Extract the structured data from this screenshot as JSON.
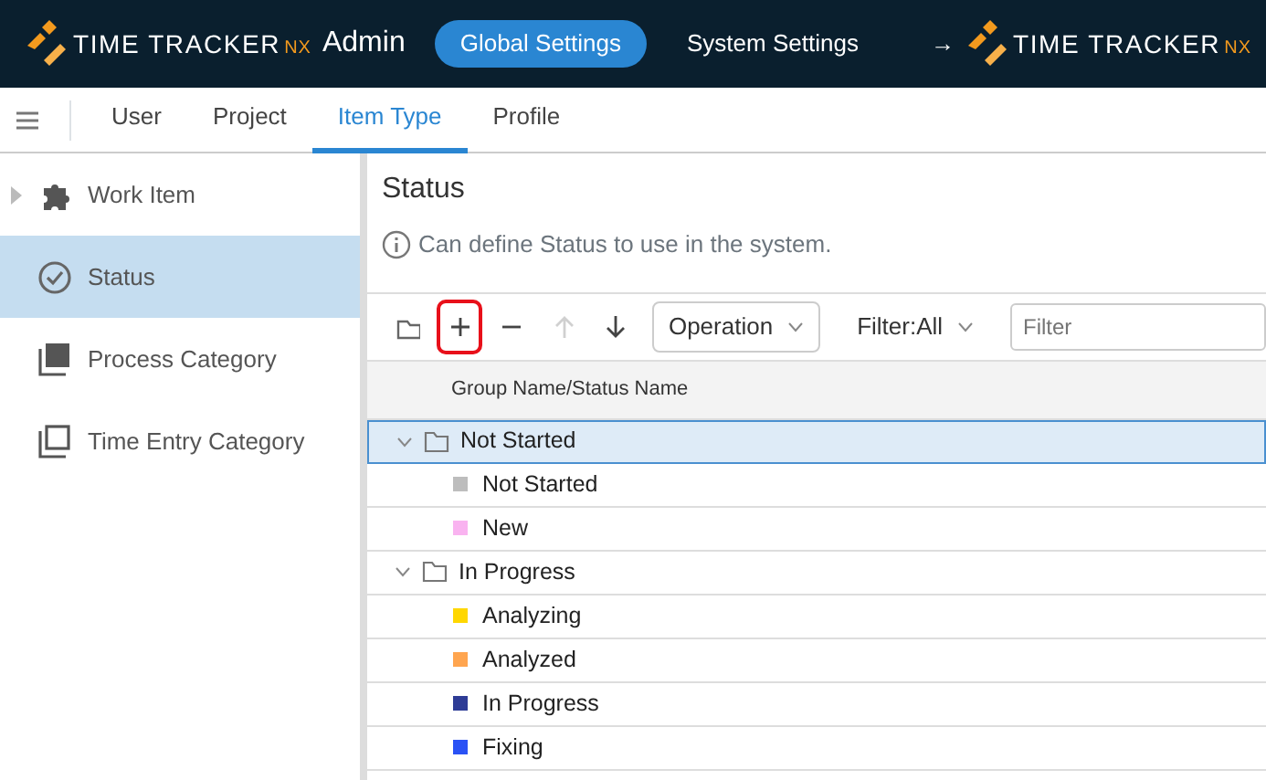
{
  "header": {
    "logo": {
      "name": "TIME TRACKER",
      "suffix": "NX",
      "role": "Admin"
    },
    "tabs": [
      {
        "label": "Global Settings",
        "selected": true
      },
      {
        "label": "System Settings",
        "selected": false
      }
    ],
    "link_arrow": "→",
    "link_logo": {
      "name": "TIME TRACKER",
      "suffix": "NX"
    }
  },
  "nav": {
    "tabs": [
      {
        "label": "User",
        "selected": false
      },
      {
        "label": "Project",
        "selected": false
      },
      {
        "label": "Item Type",
        "selected": true
      },
      {
        "label": "Profile",
        "selected": false
      }
    ]
  },
  "sidebar": {
    "items": [
      {
        "label": "Work Item",
        "kind": "puzzle",
        "selected": false,
        "expandable": true
      },
      {
        "label": "Status",
        "kind": "check",
        "selected": true,
        "expandable": false
      },
      {
        "label": "Process Category",
        "kind": "stack-filled",
        "selected": false,
        "expandable": false
      },
      {
        "label": "Time Entry Category",
        "kind": "stack-outline",
        "selected": false,
        "expandable": false
      }
    ]
  },
  "main": {
    "title": "Status",
    "info": "Can define Status to use in the system.",
    "toolbar": {
      "buttons": [
        {
          "kind": "folder",
          "disabled": false,
          "highlighted": false
        },
        {
          "kind": "add",
          "disabled": false,
          "highlighted": true
        },
        {
          "kind": "remove",
          "disabled": false,
          "highlighted": false
        },
        {
          "kind": "up",
          "disabled": true,
          "highlighted": false
        },
        {
          "kind": "down",
          "disabled": false,
          "highlighted": false
        }
      ],
      "operation": "Operation",
      "filter_menu": "Filter:All",
      "filter": {
        "placeholder": "Filter"
      }
    },
    "tree": {
      "column": "Group Name/Status Name",
      "groups": [
        {
          "label": "Not Started",
          "expanded": true,
          "selected": true,
          "children": [
            {
              "label": "Not Started",
              "color": "#bdbdbd"
            },
            {
              "label": "New",
              "color": "#f9b3f0"
            }
          ]
        },
        {
          "label": "In Progress",
          "expanded": true,
          "selected": false,
          "children": [
            {
              "label": "Analyzing",
              "color": "#ffd700"
            },
            {
              "label": "Analyzed",
              "color": "#ffa54f"
            },
            {
              "label": "In Progress",
              "color": "#2e3c96"
            },
            {
              "label": "Fixing",
              "color": "#2a52f5"
            }
          ]
        }
      ]
    }
  }
}
